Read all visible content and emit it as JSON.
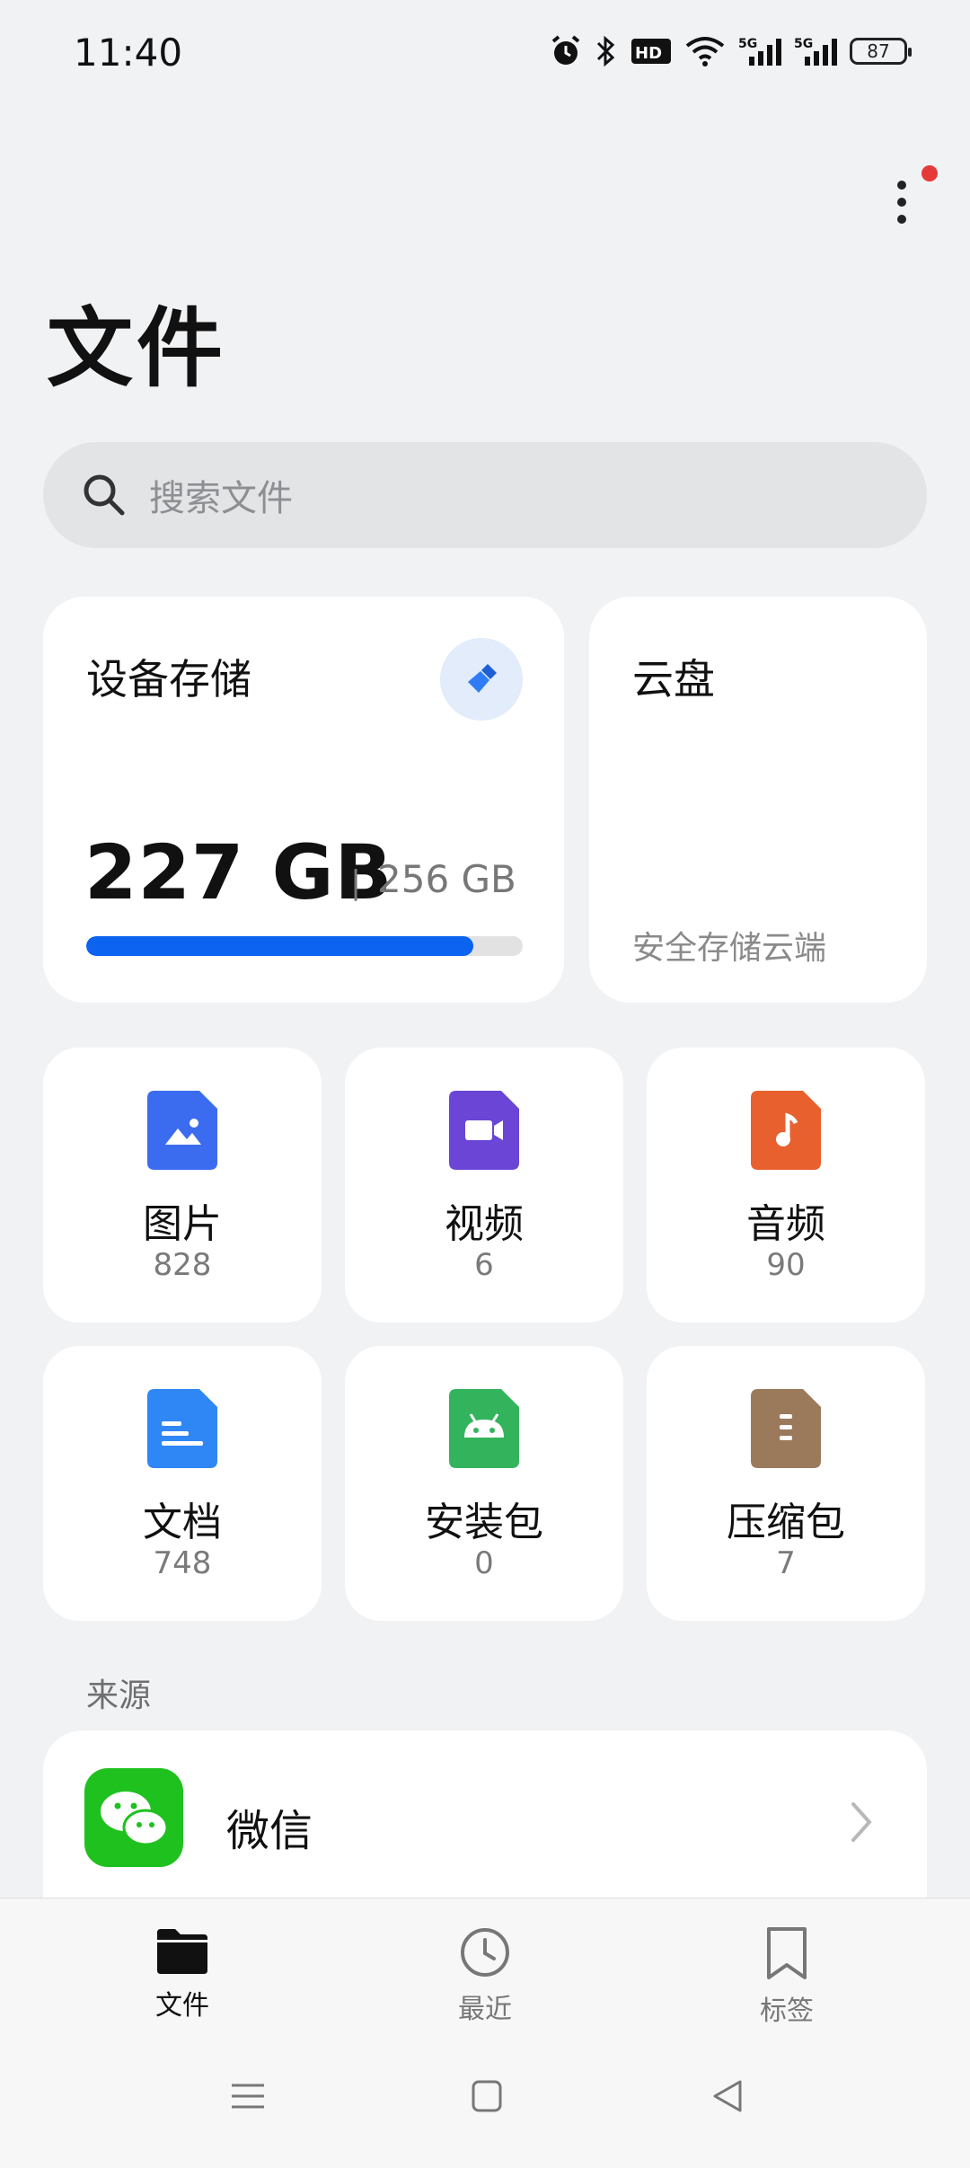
{
  "status": {
    "time": "11:40",
    "icons": [
      "alarm-icon",
      "bluetooth-icon",
      "hd-icon",
      "wifi-icon",
      "signal-5g-icon",
      "signal-5g-icon"
    ],
    "battery": "87"
  },
  "header": {
    "title": "文件",
    "has_notification_dot": true
  },
  "search": {
    "placeholder": "搜索文件"
  },
  "storage": {
    "title": "设备存储",
    "used": "227 GB",
    "separator": "|",
    "total": "256 GB",
    "used_fraction": 0.887,
    "bar_color": "#0b63f0"
  },
  "cloud": {
    "title": "云盘",
    "subtitle": "安全存储云端"
  },
  "categories": [
    {
      "label": "图片",
      "count": "828",
      "color": "#3b6cf0",
      "icon": "image-icon"
    },
    {
      "label": "视频",
      "count": "6",
      "color": "#6a45d6",
      "icon": "video-icon"
    },
    {
      "label": "音频",
      "count": "90",
      "color": "#e8602e",
      "icon": "music-icon"
    },
    {
      "label": "文档",
      "count": "748",
      "color": "#2f86f5",
      "icon": "document-icon"
    },
    {
      "label": "安装包",
      "count": "0",
      "color": "#33b45c",
      "icon": "android-icon"
    },
    {
      "label": "压缩包",
      "count": "7",
      "color": "#9b7a5c",
      "icon": "archive-icon"
    }
  ],
  "sources": {
    "label": "来源",
    "items": [
      {
        "label": "微信",
        "icon": "wechat-icon",
        "color": "#1fc11f"
      }
    ]
  },
  "bottom_nav": [
    {
      "label": "文件",
      "icon": "folder-icon",
      "active": true
    },
    {
      "label": "最近",
      "icon": "clock-icon",
      "active": false
    },
    {
      "label": "标签",
      "icon": "bookmark-icon",
      "active": false
    }
  ],
  "system_nav": [
    "menu-icon",
    "home-icon",
    "back-icon"
  ]
}
